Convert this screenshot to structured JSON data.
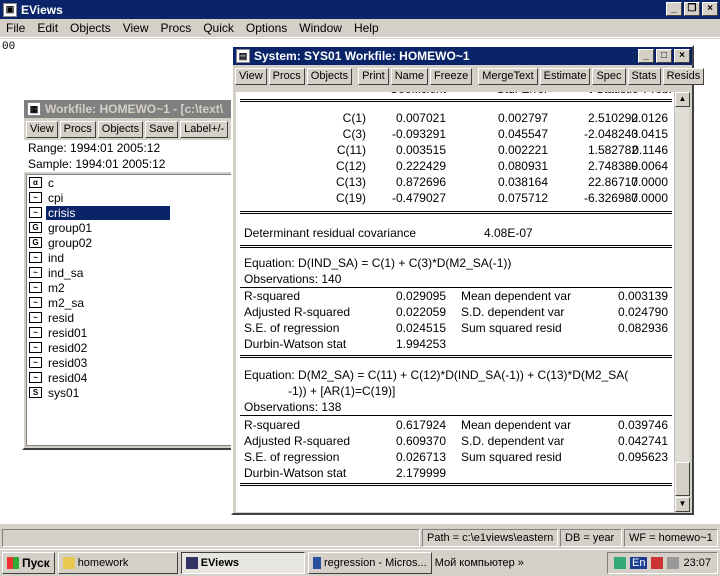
{
  "app": {
    "title": "EViews",
    "menu": [
      "File",
      "Edit",
      "Objects",
      "View",
      "Procs",
      "Quick",
      "Options",
      "Window",
      "Help"
    ],
    "command_text": "00"
  },
  "workfile": {
    "title": "Workfile: HOMEWO~1 - [c:\\text\\",
    "buttons": [
      "View",
      "Procs",
      "Objects",
      "Save",
      "Label+/-"
    ],
    "range": "Range:   1994:01 2005:12",
    "sample": "Sample: 1994:01 2005:12",
    "objects": [
      {
        "icon": "α",
        "label": "c"
      },
      {
        "icon": "~",
        "label": "cpi"
      },
      {
        "icon": "~",
        "label": "crisis",
        "selected": true
      },
      {
        "icon": "G",
        "label": "group01"
      },
      {
        "icon": "G",
        "label": "group02"
      },
      {
        "icon": "~",
        "label": "ind"
      },
      {
        "icon": "~",
        "label": "ind_sa"
      },
      {
        "icon": "~",
        "label": "m2"
      },
      {
        "icon": "~",
        "label": "m2_sa"
      },
      {
        "icon": "~",
        "label": "resid"
      },
      {
        "icon": "~",
        "label": "resid01"
      },
      {
        "icon": "~",
        "label": "resid02"
      },
      {
        "icon": "~",
        "label": "resid03"
      },
      {
        "icon": "~",
        "label": "resid04"
      },
      {
        "icon": "S",
        "label": "sys01"
      }
    ]
  },
  "system": {
    "title": "System: SYS01    Workfile: HOMEWO~1",
    "buttons": [
      "View",
      "Procs",
      "Objects",
      "Print",
      "Name",
      "Freeze",
      "MergeText",
      "Estimate",
      "Spec",
      "Stats",
      "Resids"
    ],
    "header_partial": [
      "Coefficient",
      "Std. Error",
      "t-Statistic",
      "Prob."
    ],
    "coef_rows": [
      [
        "C(1)",
        "0.007021",
        "0.002797",
        "2.510292",
        "0.0126"
      ],
      [
        "C(3)",
        "-0.093291",
        "0.045547",
        "-2.048243",
        "0.0415"
      ],
      [
        "C(11)",
        "0.003515",
        "0.002221",
        "1.582782",
        "0.1146"
      ],
      [
        "C(12)",
        "0.222429",
        "0.080931",
        "2.748389",
        "0.0064"
      ],
      [
        "C(13)",
        "0.872696",
        "0.038164",
        "22.86717",
        "0.0000"
      ],
      [
        "C(19)",
        "-0.479027",
        "0.075712",
        "-6.326987",
        "0.0000"
      ]
    ],
    "det_label": "Determinant residual covariance",
    "det_value": "4.08E-07",
    "eq1": {
      "equation": "Equation: D(IND_SA) = C(1) + C(3)*D(M2_SA(-1))",
      "observations": "Observations: 140",
      "stats": [
        [
          "R-squared",
          "0.029095",
          "Mean dependent var",
          "0.003139"
        ],
        [
          "Adjusted R-squared",
          "0.022059",
          "S.D. dependent var",
          "0.024790"
        ],
        [
          "S.E. of regression",
          "0.024515",
          "Sum squared resid",
          "0.082936"
        ],
        [
          "Durbin-Watson stat",
          "1.994253",
          "",
          ""
        ]
      ]
    },
    "eq2": {
      "equation_line1": "Equation: D(M2_SA) = C(11) + C(12)*D(IND_SA(-1)) + C(13)*D(M2_SA(",
      "equation_line2": "-1)) + [AR(1)=C(19)]",
      "observations": "Observations: 138",
      "stats": [
        [
          "R-squared",
          "0.617924",
          "Mean dependent var",
          "0.039746"
        ],
        [
          "Adjusted R-squared",
          "0.609370",
          "S.D. dependent var",
          "0.042741"
        ],
        [
          "S.E. of regression",
          "0.026713",
          "Sum squared resid",
          "0.095623"
        ],
        [
          "Durbin-Watson stat",
          "2.179999",
          "",
          ""
        ]
      ]
    }
  },
  "status": {
    "path": "Path = c:\\e1views\\eastern",
    "db": "DB = year",
    "wf": "WF = homewo~1"
  },
  "taskbar": {
    "start": "Пуск",
    "tasks": [
      "homework",
      "EViews",
      "regression - Micros..."
    ],
    "desktop": "Мой компьютер",
    "lang": "En",
    "clock": "23:07"
  }
}
